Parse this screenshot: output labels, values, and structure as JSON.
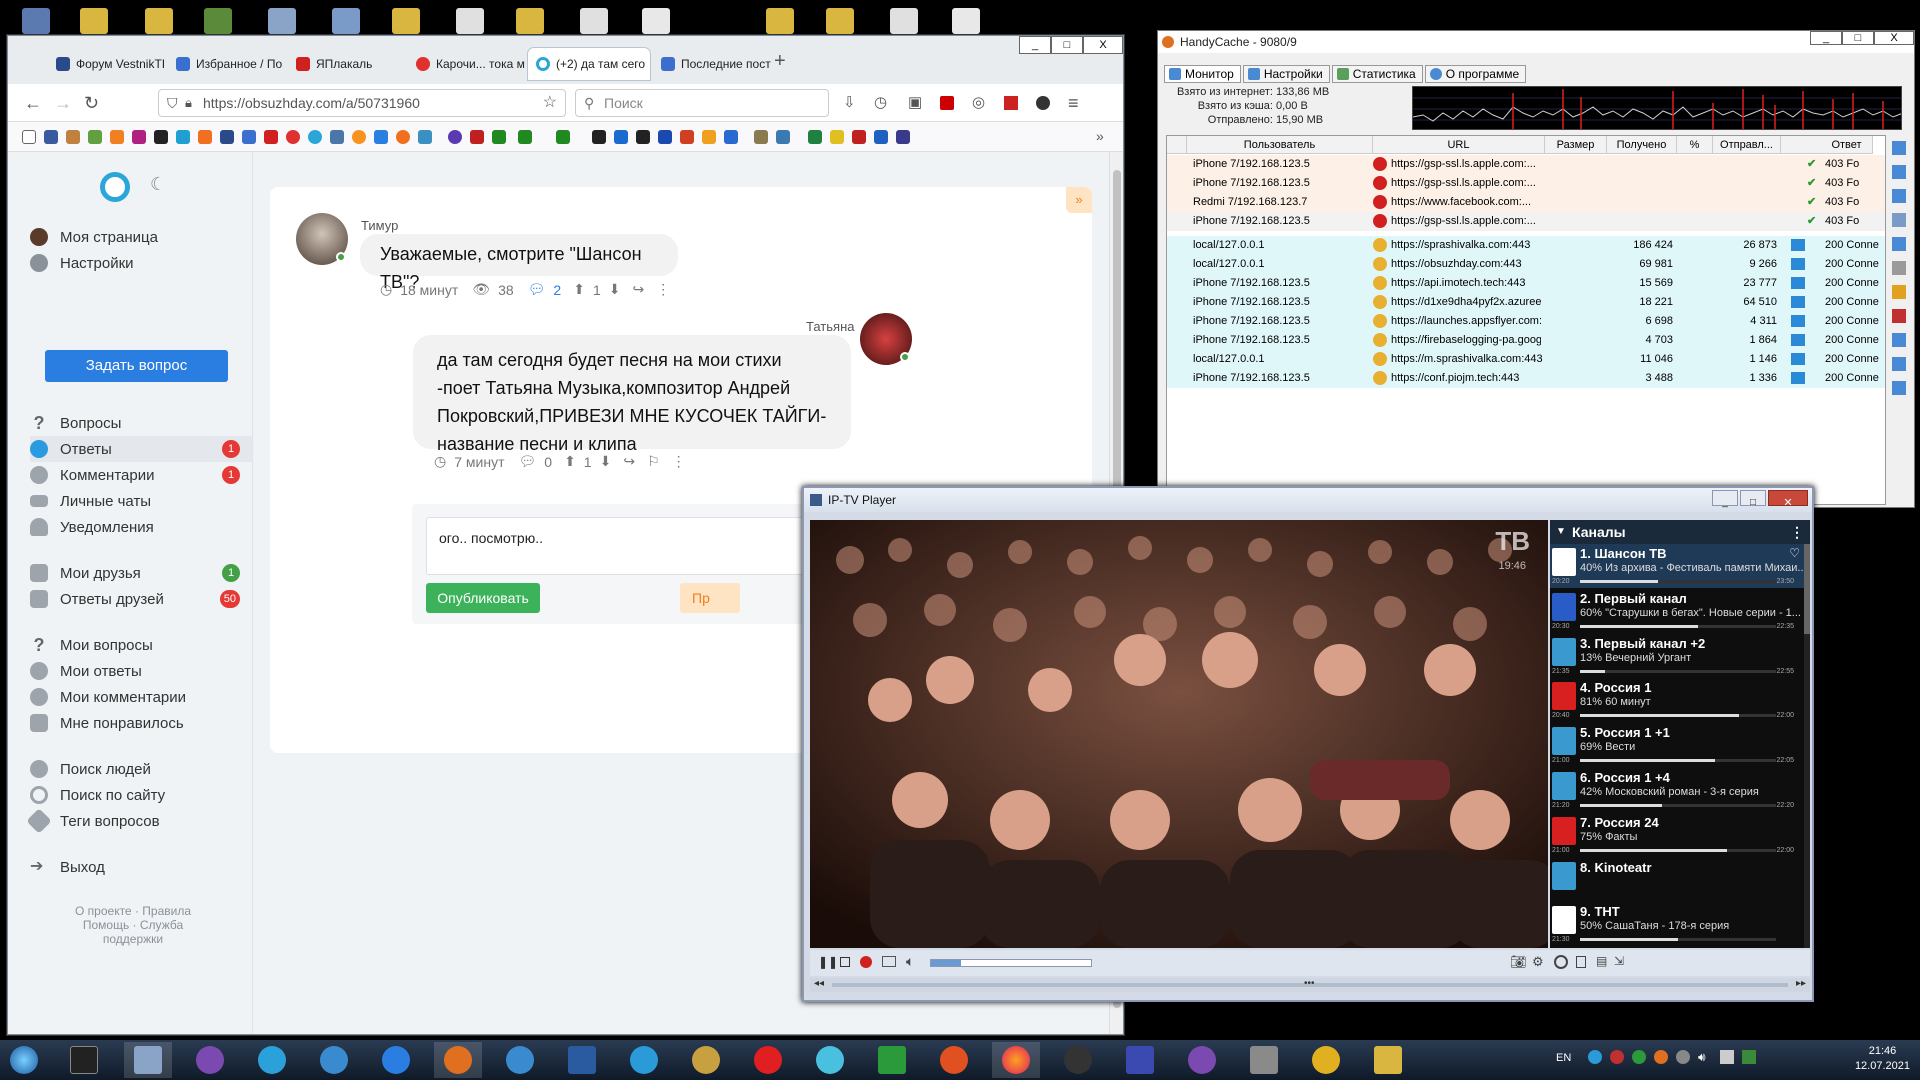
{
  "browser": {
    "tabs": [
      {
        "label": "Форум VestnikTI",
        "color": "#2a4a8a"
      },
      {
        "label": "Избранное / По",
        "color": "#3a6fd0"
      },
      {
        "label": "ЯПлакаль",
        "color": "#d02020"
      },
      {
        "label": "Карочи... тока м",
        "color": "#e03030"
      },
      {
        "label": "(+2) да там сего",
        "color": "#2aa7d8"
      },
      {
        "label": "Последние пост",
        "color": "#3a6fd0"
      }
    ],
    "url": "https://obsuzhday.com/a/50731960",
    "search_placeholder": "Поиск",
    "new_tab_label": "+",
    "window_buttons": [
      "_",
      "□",
      "X"
    ]
  },
  "sidebar": {
    "items": [
      {
        "label": "Моя страница",
        "badge": ""
      },
      {
        "label": "Настройки",
        "badge": ""
      },
      {
        "label": "Вопросы",
        "badge": ""
      },
      {
        "label": "Ответы",
        "badge": "1"
      },
      {
        "label": "Комментарии",
        "badge": "1"
      },
      {
        "label": "Личные чаты",
        "badge": ""
      },
      {
        "label": "Уведомления",
        "badge": ""
      },
      {
        "label": "Мои друзья",
        "badge": "1"
      },
      {
        "label": "Ответы друзей",
        "badge": "50"
      },
      {
        "label": "Мои вопросы",
        "badge": ""
      },
      {
        "label": "Мои ответы",
        "badge": ""
      },
      {
        "label": "Мои комментарии",
        "badge": ""
      },
      {
        "label": "Мне понравилось",
        "badge": ""
      },
      {
        "label": "Поиск людей",
        "badge": ""
      },
      {
        "label": "Поиск по сайту",
        "badge": ""
      },
      {
        "label": "Теги вопросов",
        "badge": ""
      },
      {
        "label": "Выход",
        "badge": ""
      }
    ],
    "ask_button": "Задать вопрос",
    "footer_line1": "О проекте · Правила",
    "footer_line2": "Помощь · Служба",
    "footer_line3": "поддержки"
  },
  "thread": {
    "msg1": {
      "author": "Тимур",
      "text": "Уважаемые, смотрите \"Шансон ТВ\"?",
      "time": "18 минут",
      "views": "38",
      "comments": "2",
      "votes": "1"
    },
    "msg2": {
      "author": "Татьяна",
      "text": "да там сегодня будет песня на мои стихи -поет Татьяна Музыка,композитор Андрей Покровский,ПРИВЕЗИ МНЕ КУСОЧЕК ТАЙГИ- название песни и клипа",
      "time": "7 минут",
      "comments": "0",
      "votes": "1"
    },
    "reply_text": "ого.. посмотрю..",
    "publish_button": "Опубликовать",
    "secondary_button": "Пр"
  },
  "handycache": {
    "title": "HandyCache - 9080/9",
    "tabs": [
      "Монитор",
      "Настройки",
      "Статистика",
      "О программе"
    ],
    "stats": [
      {
        "label": "Взято из интернет:",
        "value": "133,86 MB"
      },
      {
        "label": "Взято из кэша:",
        "value": "0,00 B"
      },
      {
        "label": "Отправлено:",
        "value": "15,90 MB"
      }
    ],
    "columns": [
      "Пользователь",
      "URL",
      "Размер",
      "Получено",
      "%",
      "Отправл...",
      "Ответ"
    ],
    "rows_blocked": [
      {
        "user": "iPhone 7/192.168.123.5",
        "url": "https://gsp-ssl.ls.apple.com:...",
        "resp": "403 Fo"
      },
      {
        "user": "iPhone 7/192.168.123.5",
        "url": "https://gsp-ssl.ls.apple.com:...",
        "resp": "403 Fo"
      },
      {
        "user": "Redmi 7/192.168.123.7",
        "url": "https://www.facebook.com:...",
        "resp": "403 Fo"
      },
      {
        "user": "iPhone 7/192.168.123.5",
        "url": "https://gsp-ssl.ls.apple.com:...",
        "resp": "403 Fo"
      }
    ],
    "rows_ok": [
      {
        "user": "local/127.0.0.1",
        "url": "https://sprashivalka.com:443",
        "got": "186 424",
        "sent": "26 873",
        "resp": "200 Conne"
      },
      {
        "user": "local/127.0.0.1",
        "url": "https://obsuzhday.com:443",
        "got": "69 981",
        "sent": "9 266",
        "resp": "200 Conne"
      },
      {
        "user": "iPhone 7/192.168.123.5",
        "url": "https://api.imotech.tech:443",
        "got": "15 569",
        "sent": "23 777",
        "resp": "200 Conne"
      },
      {
        "user": "iPhone 7/192.168.123.5",
        "url": "https://d1xe9dha4pyf2x.azureed...",
        "got": "18 221",
        "sent": "64 510",
        "resp": "200 Conne"
      },
      {
        "user": "iPhone 7/192.168.123.5",
        "url": "https://launches.appsflyer.com:...",
        "got": "6 698",
        "sent": "4 311",
        "resp": "200 Conne"
      },
      {
        "user": "iPhone 7/192.168.123.5",
        "url": "https://firebaselogging-pa.googl...",
        "got": "4 703",
        "sent": "1 864",
        "resp": "200 Conne"
      },
      {
        "user": "local/127.0.0.1",
        "url": "https://m.sprashivalka.com:443",
        "got": "11 046",
        "sent": "1 146",
        "resp": "200 Conne"
      },
      {
        "user": "iPhone 7/192.168.123.5",
        "url": "https://conf.piojm.tech:443",
        "got": "3 488",
        "sent": "1 336",
        "resp": "200 Conne"
      }
    ]
  },
  "iptv": {
    "title": "IP-TV Player",
    "channels_header": "Каналы",
    "video_logo": "TB",
    "video_clock": "19:46",
    "channels": [
      {
        "name": "1. Шансон ТВ",
        "desc": "40% Из архива - Фестиваль памяти Михаи...",
        "start": "20:20",
        "end": "23:50",
        "progress": 0.4,
        "color": "#ffffff"
      },
      {
        "name": "2. Первый канал",
        "desc": "60% \"Старушки в бегах\". Новые серии - 1...",
        "start": "20:30",
        "end": "22:35",
        "progress": 0.6,
        "color": "#2a5cc8"
      },
      {
        "name": "3. Первый канал +2",
        "desc": "13% Вечерний Ургант",
        "start": "21:35",
        "end": "22:55",
        "progress": 0.13,
        "color": "#3a9ad0"
      },
      {
        "name": "4. Россия 1",
        "desc": "81% 60 минут",
        "start": "20:40",
        "end": "22:00",
        "progress": 0.81,
        "color": "#d82020"
      },
      {
        "name": "5. Россия 1 +1",
        "desc": "69% Вести",
        "start": "21:00",
        "end": "22:05",
        "progress": 0.69,
        "color": "#3a9ad0"
      },
      {
        "name": "6. Россия 1 +4",
        "desc": "42% Московский роман - 3-я серия",
        "start": "21:20",
        "end": "22:20",
        "progress": 0.42,
        "color": "#3a9ad0"
      },
      {
        "name": "7. Россия 24",
        "desc": "75% Факты",
        "start": "21:00",
        "end": "22:00",
        "progress": 0.75,
        "color": "#d82020"
      },
      {
        "name": "8. Kinoteatr",
        "desc": "",
        "start": "",
        "end": "",
        "progress": 0,
        "color": "#3a9ad0"
      },
      {
        "name": "9. ТНТ",
        "desc": "50% СашаТаня - 178-я серия",
        "start": "21:30",
        "end": "",
        "progress": 0.5,
        "color": "#ffffff"
      }
    ]
  },
  "taskbar": {
    "lang": "EN",
    "time": "21:46",
    "date": "12.07.2021"
  }
}
